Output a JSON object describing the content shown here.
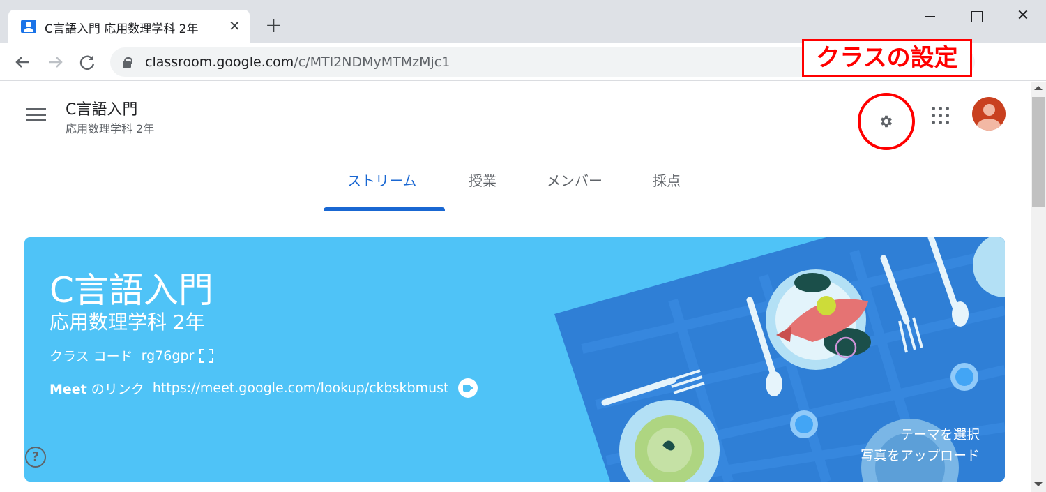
{
  "browser": {
    "tab_title": "C言語入門 応用数理学科 2年",
    "tab_close": "✕",
    "new_tab": "+",
    "window_close": "✕",
    "url_host": "classroom.google.com",
    "url_path": "/c/MTI2NDMyMTMzMjc1",
    "annotation": "クラスの設定"
  },
  "header": {
    "class_name": "C言語入門",
    "class_section": "応用数理学科 2年"
  },
  "tabs": [
    {
      "label": "ストリーム",
      "active": true
    },
    {
      "label": "授業",
      "active": false
    },
    {
      "label": "メンバー",
      "active": false
    },
    {
      "label": "採点",
      "active": false
    }
  ],
  "banner": {
    "title": "C言語入門",
    "subtitle": "応用数理学科 2年",
    "class_code_label": "クラス コード",
    "class_code": "rg76gpr",
    "meet_label_bold": "Meet",
    "meet_label_rest": " のリンク",
    "meet_url": "https://meet.google.com/lookup/ckbskbmust",
    "select_theme": "テーマを選択",
    "upload_photo": "写真をアップロード"
  },
  "help": "?",
  "colors": {
    "accent": "#1967d2",
    "banner": "#4fc3f7",
    "annotation": "#ff0000",
    "avatar": "#c9401f"
  },
  "icons": [
    "classroom-favicon",
    "close-icon",
    "plus-icon",
    "minimize-icon",
    "maximize-icon",
    "back-arrow-icon",
    "forward-arrow-icon",
    "reload-icon",
    "lock-icon",
    "kebab-icon",
    "hamburger-icon",
    "gear-icon",
    "apps-grid-icon",
    "expand-icon",
    "meet-icon",
    "help-icon"
  ]
}
